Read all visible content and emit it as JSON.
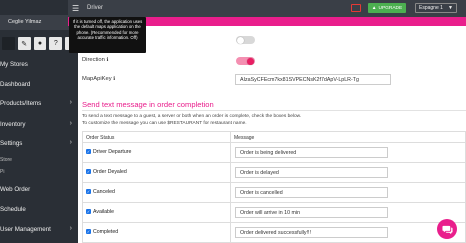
{
  "sidebar": {
    "user": "Ceglie Yilmaz",
    "items": [
      {
        "label": "My Stores",
        "chevron": false
      },
      {
        "label": "Dashboard",
        "chevron": false
      },
      {
        "label": "Products/Items",
        "chevron": true
      },
      {
        "label": "Inventory",
        "chevron": true
      },
      {
        "label": "Settings",
        "chevron": true
      },
      {
        "label": "Store",
        "small": true
      },
      {
        "label": "Pi",
        "small": true
      },
      {
        "label": "Web Order",
        "chevron": false
      },
      {
        "label": "Schedule",
        "chevron": false
      },
      {
        "label": "User Management",
        "chevron": true
      }
    ]
  },
  "topbar": {
    "title": "Driver",
    "upgrade_label": "UPGRADE",
    "store_select": "Espagne 1"
  },
  "tooltip": "If it is turned off, the application uses the default maps application on the phone. (Recommended for more accurate traffic information. Off)",
  "settings": {
    "direction_label": "Direction",
    "direction_info": "ℹ",
    "direction_on": true,
    "maps_toggle_on": false,
    "api_label": "MapApiKey",
    "api_info": "ℹ",
    "api_value": "AIzaSyCFEcm7kx81SVPECNsK2f7dApV-LpLR-Tg"
  },
  "section": {
    "title": "Send text message in order completion",
    "desc1": "To send a text message to a guest, a server or both when an order is complete, check the boxes below.",
    "desc2": "To customize the message you can use $RESTAURANT for restaurant name.",
    "col_status": "Order Status",
    "col_message": "Message",
    "rows": [
      {
        "status": "Driver Departure",
        "message": "Order is being delivered",
        "checked": true
      },
      {
        "status": "Order Deyaled",
        "message": "Order is delayed",
        "checked": true
      },
      {
        "status": "Canceled",
        "message": "Order is cancelled",
        "checked": true
      },
      {
        "status": "Available",
        "message": "Order will arrive in 10 min",
        "checked": true
      },
      {
        "status": "Completed",
        "message": "Order delivered successfully!!!",
        "checked": true
      }
    ]
  },
  "colors": {
    "accent": "#e91e8c",
    "sidebar_bg": "#2a2f36",
    "upgrade_bg": "#4caf50"
  },
  "icons": {
    "menu": "hamburger-icon",
    "tv": "tv-icon",
    "chat": "chat-icon"
  }
}
